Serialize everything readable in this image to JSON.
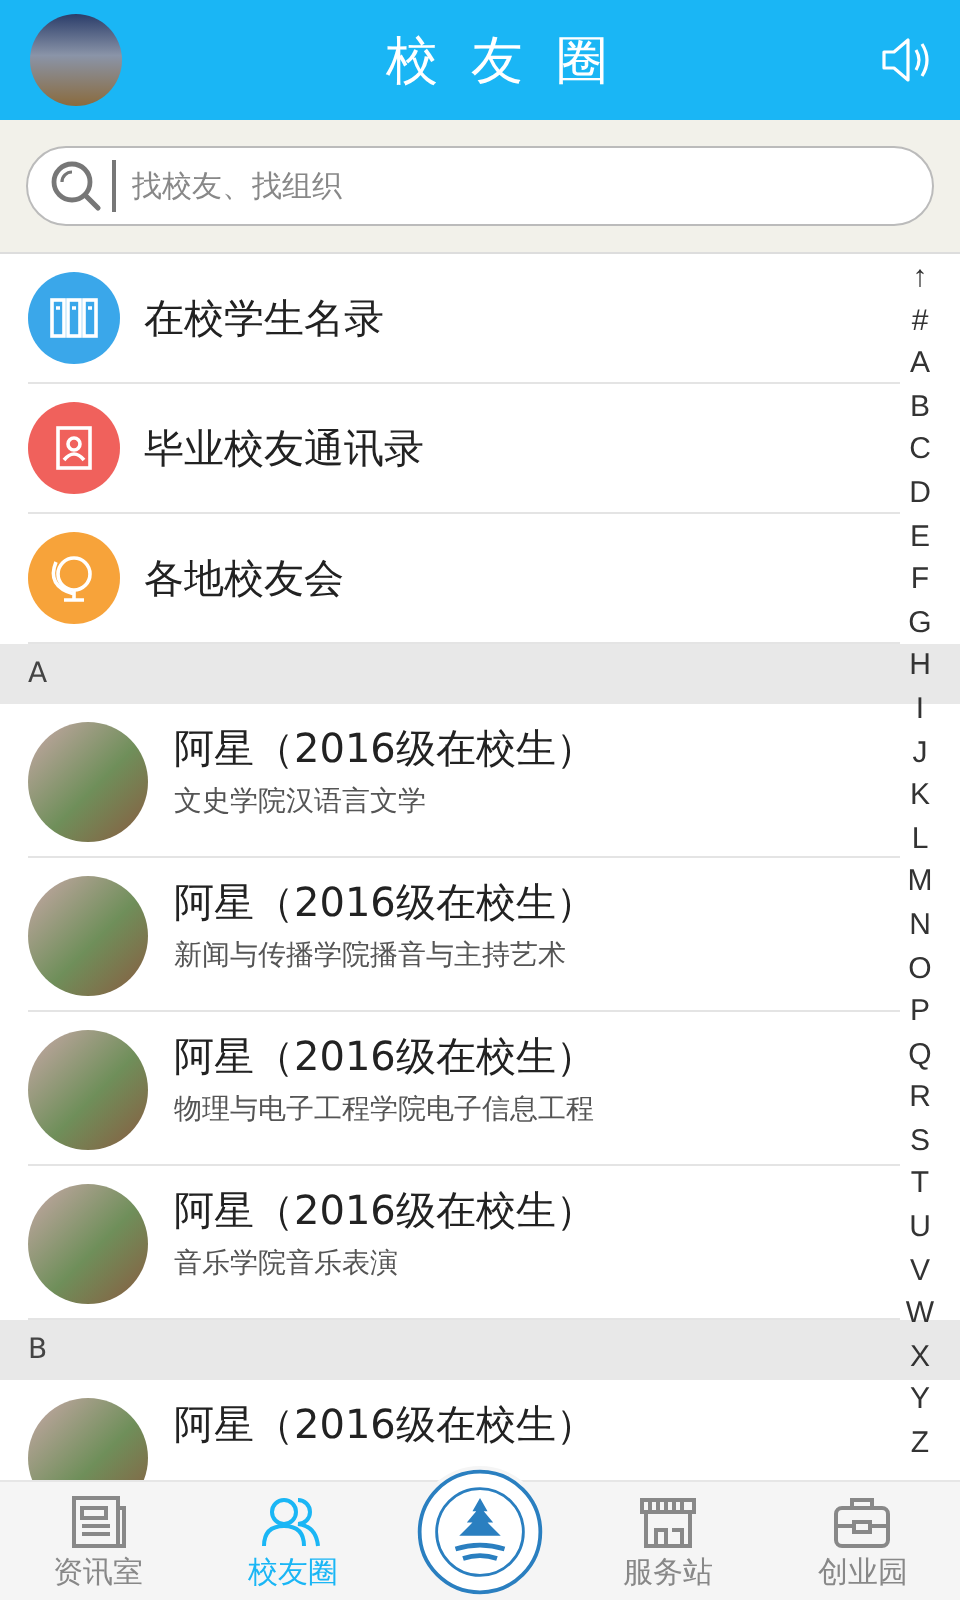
{
  "header": {
    "title": "校 友 圈"
  },
  "search": {
    "placeholder": "找校友、找组织"
  },
  "menu": [
    {
      "label": "在校学生名录",
      "color": "#3aa7ea",
      "kind": "book"
    },
    {
      "label": "毕业校友通讯录",
      "color": "#f0615c",
      "kind": "contact"
    },
    {
      "label": "各地校友会",
      "color": "#f7a33a",
      "kind": "globe"
    }
  ],
  "sections": [
    {
      "letter": "A",
      "people": [
        {
          "name": "阿星（2016级在校生）",
          "detail": "文史学院汉语言文学"
        },
        {
          "name": "阿星（2016级在校生）",
          "detail": "新闻与传播学院播音与主持艺术"
        },
        {
          "name": "阿星（2016级在校生）",
          "detail": "物理与电子工程学院电子信息工程"
        },
        {
          "name": "阿星（2016级在校生）",
          "detail": "音乐学院音乐表演"
        }
      ]
    },
    {
      "letter": "B",
      "people": [
        {
          "name": "阿星（2016级在校生）"
        }
      ]
    }
  ],
  "index": [
    "↑",
    "#",
    "A",
    "B",
    "C",
    "D",
    "E",
    "F",
    "G",
    "H",
    "I",
    "J",
    "K",
    "L",
    "M",
    "N",
    "O",
    "P",
    "Q",
    "R",
    "S",
    "T",
    "U",
    "V",
    "W",
    "X",
    "Y",
    "Z"
  ],
  "tabs": [
    {
      "kind": "news",
      "label": "资讯室",
      "selected": false
    },
    {
      "kind": "people",
      "label": "校友圈",
      "selected": true
    },
    {
      "kind": "logo"
    },
    {
      "kind": "shop",
      "label": "服务站",
      "selected": false
    },
    {
      "kind": "case",
      "label": "创业园",
      "selected": false
    }
  ]
}
